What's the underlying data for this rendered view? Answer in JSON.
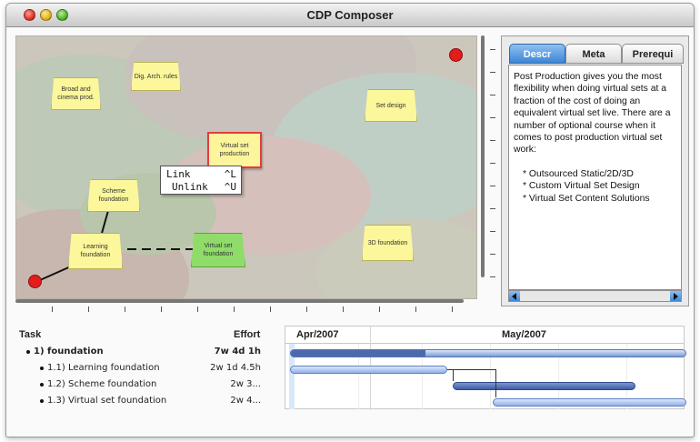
{
  "window": {
    "title": "CDP Composer"
  },
  "canvas": {
    "nodes": [
      {
        "label": "Broad and cinema prod.",
        "style": "normal"
      },
      {
        "label": "Dig. Arch. rules",
        "style": "normal"
      },
      {
        "label": "Set design",
        "style": "normal"
      },
      {
        "label": "Virtual set production",
        "style": "selected"
      },
      {
        "label": "Scheme foundation",
        "style": "normal"
      },
      {
        "label": "Learning foundation",
        "style": "normal"
      },
      {
        "label": "Virtual set foundation",
        "style": "green"
      },
      {
        "label": "3D foundation",
        "style": "normal"
      }
    ],
    "context_menu": {
      "items": [
        {
          "label": "Link",
          "shortcut": "^L"
        },
        {
          "label": "Unlink",
          "shortcut": "^U"
        }
      ]
    }
  },
  "inspector": {
    "tabs": [
      "Descr",
      "Meta",
      "Prerequi"
    ],
    "active_tab": "Descr",
    "description": "Post Production gives you the most flexibility when doing virtual sets at a fraction of the cost of doing an equivalent virtual set live. There are a number of optional course when it comes to post production virtual set work:",
    "bullets": [
      "* Outsourced Static/2D/3D",
      "* Custom Virtual Set Design",
      "* Virtual Set Content Solutions"
    ]
  },
  "tasks": {
    "task_header": "Task",
    "effort_header": "Effort",
    "rows": [
      {
        "num": "1)",
        "name": "foundation",
        "effort": "7w 4d 1h",
        "level": 0
      },
      {
        "num": "1.1)",
        "name": "Learning foundation",
        "effort": "2w 1d 4.5h",
        "level": 1
      },
      {
        "num": "1.2)",
        "name": "Scheme foundation",
        "effort": "2w 3...",
        "level": 1
      },
      {
        "num": "1.3)",
        "name": "Virtual set foundation",
        "effort": "2w 4...",
        "level": 1
      }
    ]
  },
  "gantt": {
    "months": [
      "Apr/2007",
      "May/2007"
    ]
  }
}
